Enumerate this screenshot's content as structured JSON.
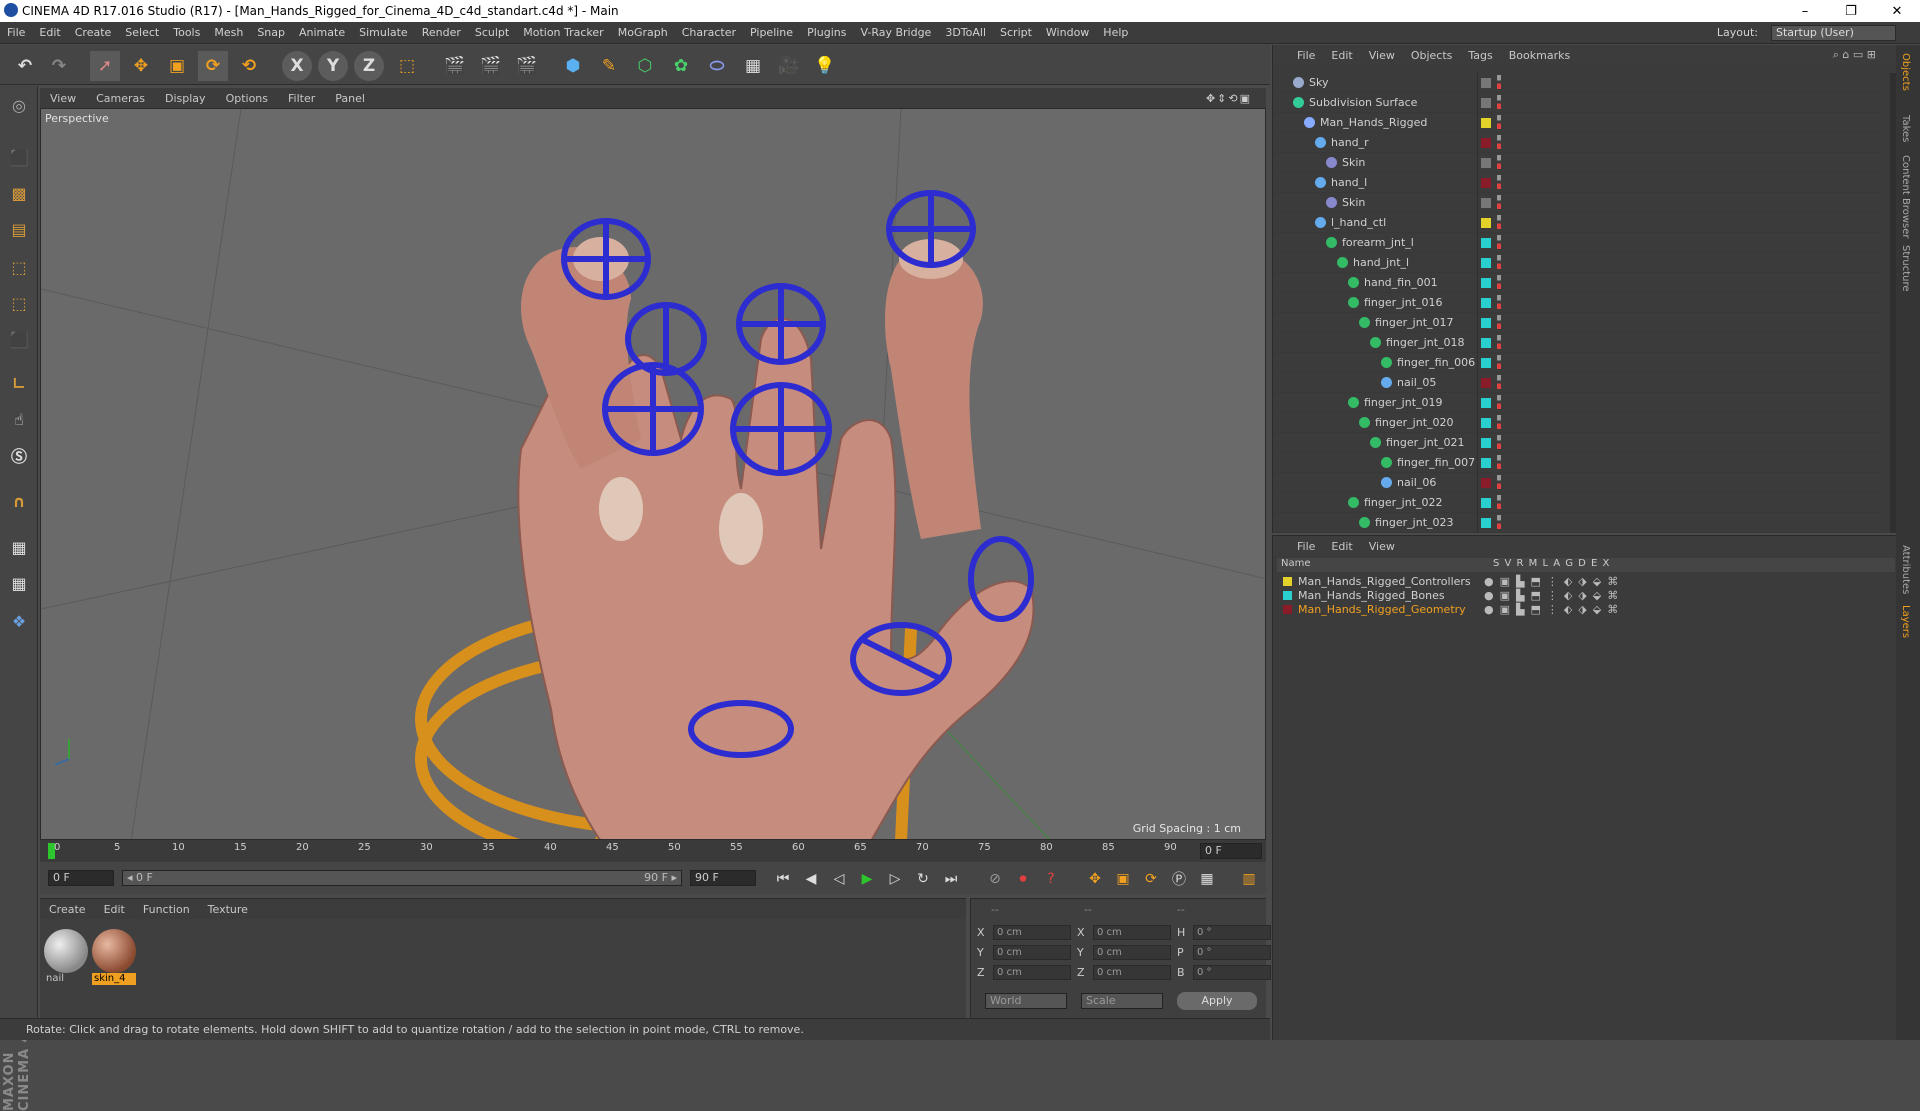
{
  "window": {
    "title": "CINEMA 4D R17.016 Studio (R17) - [Man_Hands_Rigged_for_Cinema_4D_c4d_standart.c4d *] - Main",
    "min": "–",
    "max": "❐",
    "close": "✕"
  },
  "menu": [
    "File",
    "Edit",
    "Create",
    "Select",
    "Tools",
    "Mesh",
    "Snap",
    "Animate",
    "Simulate",
    "Render",
    "Sculpt",
    "Motion Tracker",
    "MoGraph",
    "Character",
    "Pipeline",
    "Plugins",
    "V-Ray Bridge",
    "3DToAll",
    "Script",
    "Window",
    "Help"
  ],
  "layout": {
    "label": "Layout:",
    "value": "Startup (User)"
  },
  "toolbar": {
    "x": "X",
    "y": "Y",
    "z": "Z"
  },
  "viewport": {
    "menu": [
      "View",
      "Cameras",
      "Display",
      "Options",
      "Filter",
      "Panel"
    ],
    "label": "Perspective",
    "grid_spacing": "Grid Spacing : 1 cm",
    "nav": "✥⇕⟲▣"
  },
  "timeline": {
    "ticks": [
      "0",
      "5",
      "10",
      "15",
      "20",
      "25",
      "30",
      "35",
      "40",
      "45",
      "50",
      "55",
      "60",
      "65",
      "70",
      "75",
      "80",
      "85",
      "90"
    ],
    "frame_field": "0 F"
  },
  "transport": {
    "start": "0 F",
    "range_start": "◂ 0 F",
    "range_end": "90 F ▸",
    "end": "90 F"
  },
  "materials": {
    "menu": [
      "Create",
      "Edit",
      "Function",
      "Texture"
    ],
    "items": [
      {
        "name": "nail"
      },
      {
        "name": "skin_4"
      }
    ]
  },
  "coords": {
    "header": [
      "--",
      "--",
      "--"
    ],
    "rows": [
      {
        "a1": "X",
        "v1": "0 cm",
        "a2": "X",
        "v2": "0 cm",
        "a3": "H",
        "v3": "0 °"
      },
      {
        "a1": "Y",
        "v1": "0 cm",
        "a2": "Y",
        "v2": "0 cm",
        "a3": "P",
        "v3": "0 °"
      },
      {
        "a1": "Z",
        "v1": "0 cm",
        "a2": "Z",
        "v2": "0 cm",
        "a3": "B",
        "v3": "0 °"
      }
    ],
    "world": "World",
    "scale": "Scale",
    "apply": "Apply"
  },
  "status": "Rotate: Click and drag to rotate elements. Hold down SHIFT to add to quantize rotation / add to the selection in point mode, CTRL to remove.",
  "objects": {
    "menu": [
      "File",
      "Edit",
      "View",
      "Objects",
      "Tags",
      "Bookmarks"
    ],
    "rows": [
      {
        "name": "Sky",
        "indent": 0,
        "icon": "#9ac",
        "color": "#777"
      },
      {
        "name": "Subdivision Surface",
        "indent": 0,
        "icon": "#3c9",
        "color": "#777"
      },
      {
        "name": "Man_Hands_Rigged",
        "indent": 1,
        "icon": "#8af",
        "color": "#e3d22a"
      },
      {
        "name": "hand_r",
        "indent": 2,
        "icon": "#6ae",
        "color": "#8a1c2a"
      },
      {
        "name": "Skin",
        "indent": 3,
        "icon": "#88c",
        "color": "#777"
      },
      {
        "name": "hand_l",
        "indent": 2,
        "icon": "#6ae",
        "color": "#8a1c2a"
      },
      {
        "name": "Skin",
        "indent": 3,
        "icon": "#88c",
        "color": "#777"
      },
      {
        "name": "l_hand_ctl",
        "indent": 2,
        "icon": "#6ae",
        "color": "#e3d22a"
      },
      {
        "name": "forearm_jnt_l",
        "indent": 3,
        "icon": "#3b6",
        "color": "#2ad0d0"
      },
      {
        "name": "hand_jnt_l",
        "indent": 4,
        "icon": "#3b6",
        "color": "#2ad0d0"
      },
      {
        "name": "hand_fin_001",
        "indent": 5,
        "icon": "#3b6",
        "color": "#2ad0d0"
      },
      {
        "name": "finger_jnt_016",
        "indent": 5,
        "icon": "#3b6",
        "color": "#2ad0d0"
      },
      {
        "name": "finger_jnt_017",
        "indent": 6,
        "icon": "#3b6",
        "color": "#2ad0d0"
      },
      {
        "name": "finger_jnt_018",
        "indent": 7,
        "icon": "#3b6",
        "color": "#2ad0d0"
      },
      {
        "name": "finger_fin_006",
        "indent": 8,
        "icon": "#3b6",
        "color": "#2ad0d0"
      },
      {
        "name": "nail_05",
        "indent": 8,
        "icon": "#6ae",
        "color": "#8a1c2a"
      },
      {
        "name": "finger_jnt_019",
        "indent": 5,
        "icon": "#3b6",
        "color": "#2ad0d0"
      },
      {
        "name": "finger_jnt_020",
        "indent": 6,
        "icon": "#3b6",
        "color": "#2ad0d0"
      },
      {
        "name": "finger_jnt_021",
        "indent": 7,
        "icon": "#3b6",
        "color": "#2ad0d0"
      },
      {
        "name": "finger_fin_007",
        "indent": 8,
        "icon": "#3b6",
        "color": "#2ad0d0"
      },
      {
        "name": "nail_06",
        "indent": 8,
        "icon": "#6ae",
        "color": "#8a1c2a"
      },
      {
        "name": "finger_jnt_022",
        "indent": 5,
        "icon": "#3b6",
        "color": "#2ad0d0"
      },
      {
        "name": "finger_jnt_023",
        "indent": 6,
        "icon": "#3b6",
        "color": "#2ad0d0"
      }
    ]
  },
  "layers": {
    "menu": [
      "File",
      "Edit",
      "View"
    ],
    "header": {
      "name": "Name",
      "cols": "S  V  R  M  L  A  G  D  E  X"
    },
    "rows": [
      {
        "name": "Man_Hands_Rigged_Controllers",
        "color": "#e3d22a",
        "text": "#d0d0d0"
      },
      {
        "name": "Man_Hands_Rigged_Bones",
        "color": "#2ad0d0",
        "text": "#d0d0d0"
      },
      {
        "name": "Man_Hands_Rigged_Geometry",
        "color": "#8a1c2a",
        "text": "#f0a020"
      }
    ]
  },
  "right_tabs": [
    "Objects",
    "Takes",
    "Content Browser",
    "Structure",
    "Attributes",
    "Layers"
  ],
  "colors": {
    "accent": "#f0a020",
    "controller_blue": "#2c2cd0",
    "bone_orange": "#d8901c",
    "skin": "#c89080"
  }
}
